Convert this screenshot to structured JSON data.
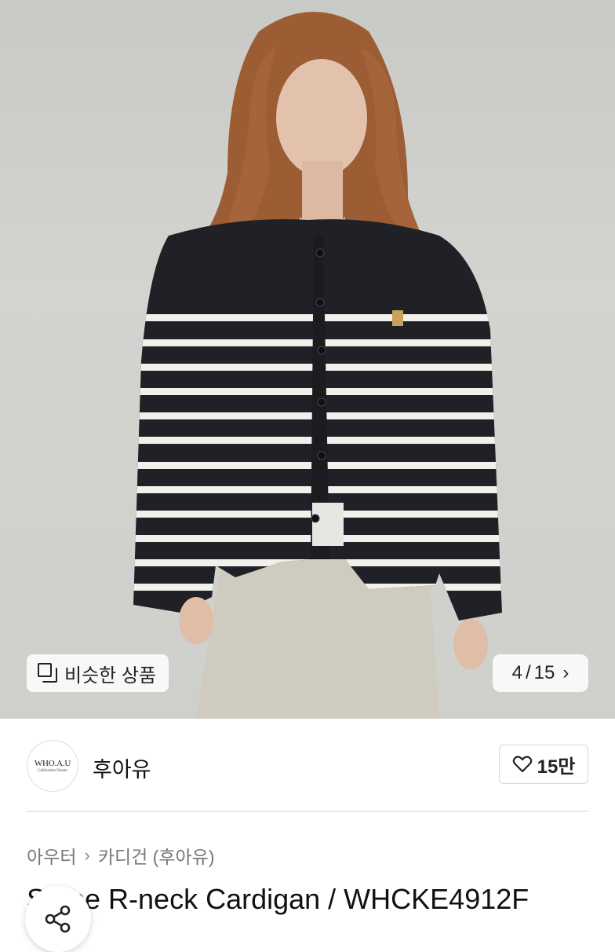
{
  "hero": {
    "similar_label": "비슷한 상품",
    "counter_current": "4",
    "counter_sep": "/",
    "counter_total": "15"
  },
  "seller": {
    "logo_text": "WHO.A.U",
    "logo_sub": "Californian Dream",
    "name": "후아유",
    "like_count": "15만"
  },
  "breadcrumb": {
    "level1": "아우터",
    "level2": "카디건 (후아유)"
  },
  "product": {
    "title": "Stripe R-neck Cardigan / WHCKE4912F"
  },
  "colors": {
    "sweater": "#1f2126",
    "stripe": "#f2f0ea",
    "pants": "#cfcbbf",
    "hair": "#a5643a"
  }
}
